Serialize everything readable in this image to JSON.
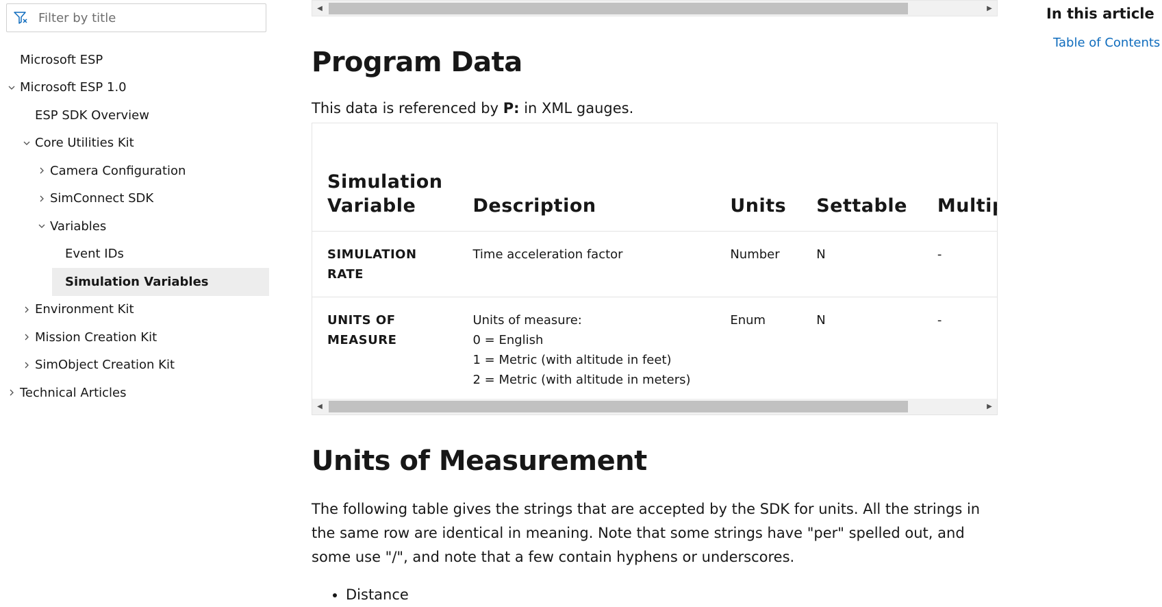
{
  "sidebar": {
    "filter_placeholder": "Filter by title",
    "items": [
      {
        "label": "Microsoft ESP",
        "chevron": "none"
      },
      {
        "label": "Microsoft ESP 1.0",
        "chevron": "down"
      },
      {
        "label": "ESP SDK Overview",
        "chevron": "none"
      },
      {
        "label": "Core Utilities Kit",
        "chevron": "down"
      },
      {
        "label": "Camera Configuration",
        "chevron": "right"
      },
      {
        "label": "SimConnect SDK",
        "chevron": "right"
      },
      {
        "label": "Variables",
        "chevron": "down"
      },
      {
        "label": "Event IDs",
        "chevron": "none"
      },
      {
        "label": "Simulation Variables",
        "chevron": "none",
        "selected": true
      },
      {
        "label": "Environment Kit",
        "chevron": "right"
      },
      {
        "label": "Mission Creation Kit",
        "chevron": "right"
      },
      {
        "label": "SimObject Creation Kit",
        "chevron": "right"
      },
      {
        "label": "Technical Articles",
        "chevron": "right"
      }
    ]
  },
  "main": {
    "section1": {
      "heading": "Program Data",
      "intro_before": "This data is referenced by ",
      "intro_code": "P:",
      "intro_after": " in XML gauges."
    },
    "table": {
      "headers": [
        "Simulation Variable",
        "Description",
        "Units",
        "Settable",
        "Multiplayer"
      ],
      "rows": [
        {
          "variable": "SIMULATION RATE",
          "description": [
            "Time acceleration factor"
          ],
          "units": "Number",
          "settable": "N",
          "multiplayer": "-"
        },
        {
          "variable": "UNITS OF MEASURE",
          "description": [
            "Units of measure:",
            "0 = English",
            "1 = Metric (with altitude in feet)",
            "2 = Metric (with altitude in meters)"
          ],
          "units": "Enum",
          "settable": "N",
          "multiplayer": "-"
        }
      ]
    },
    "section2": {
      "heading": "Units of Measurement",
      "paragraph": "The following table gives the strings that are accepted by the SDK for units. All the strings in the same row are identical in meaning. Note that some strings have \"per\" spelled out, and some use \"/\", and note that a few contain hyphens or underscores.",
      "bullets": [
        "Distance"
      ]
    }
  },
  "right_rail": {
    "title": "In this article",
    "links": [
      "Table of Contents"
    ]
  },
  "colors": {
    "link": "#0f6cbd",
    "selected_bg": "#ededed",
    "scroll_thumb": "#c1c1c1"
  }
}
